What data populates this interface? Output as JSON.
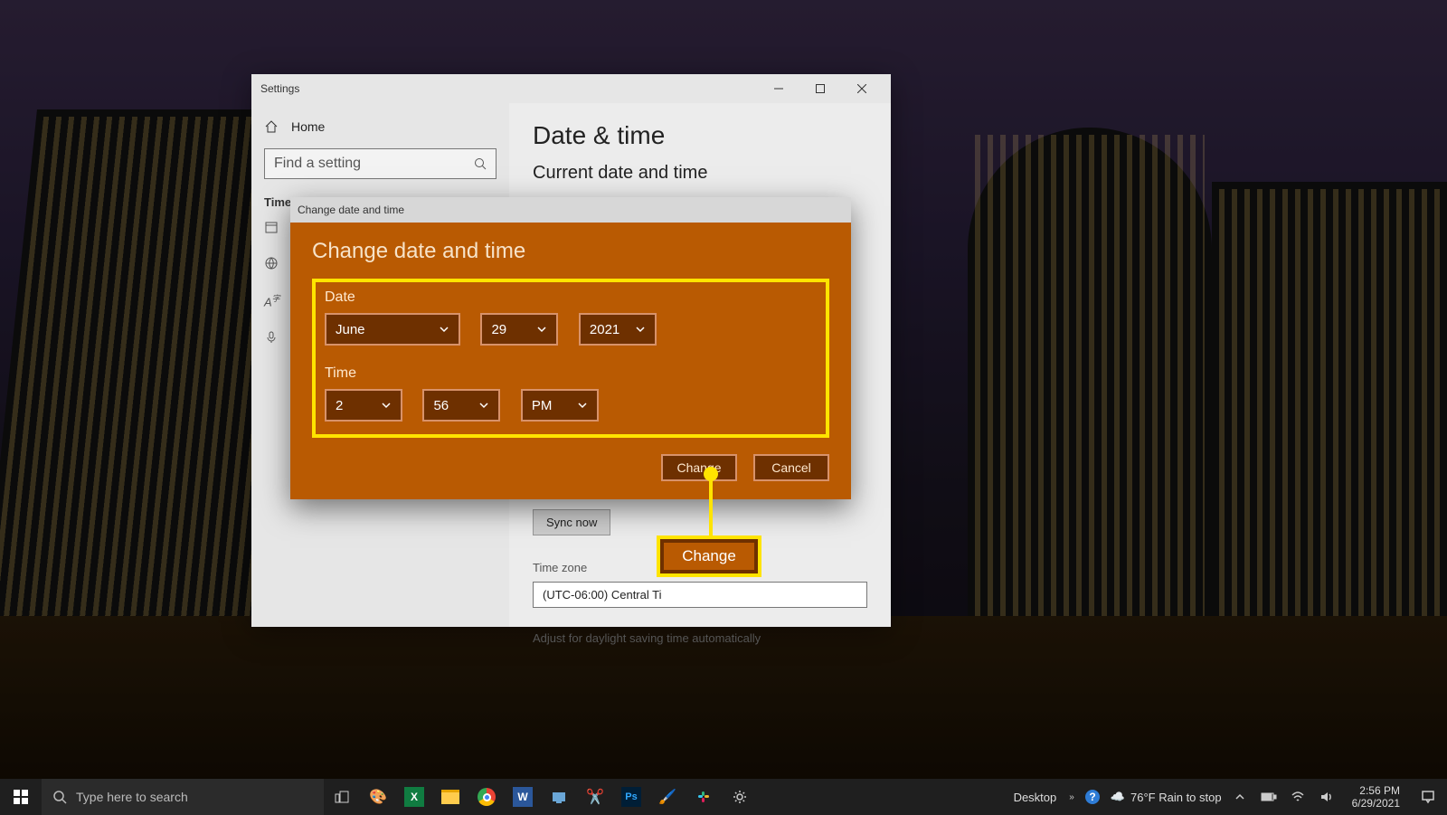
{
  "settings": {
    "window_title": "Settings",
    "home_label": "Home",
    "search_placeholder": "Find a setting",
    "sidebar_category": "Time",
    "page_title": "Date & time",
    "section_title": "Current date and time",
    "sync_now": "Sync now",
    "time_zone_label": "Time zone",
    "time_zone_value": "(UTC-06:00) Central Ti",
    "dst_label": "Adjust for daylight saving time automatically"
  },
  "dialog": {
    "title": "Change date and time",
    "heading": "Change date and time",
    "date_label": "Date",
    "time_label": "Time",
    "month": "June",
    "day": "29",
    "year": "2021",
    "hour": "2",
    "minute": "56",
    "ampm": "PM",
    "change": "Change",
    "cancel": "Cancel"
  },
  "callout": {
    "label": "Change"
  },
  "taskbar": {
    "search_placeholder": "Type here to search",
    "desktop_label": "Desktop",
    "weather": "76°F  Rain to stop",
    "clock_time": "2:56 PM",
    "clock_date": "6/29/2021"
  }
}
